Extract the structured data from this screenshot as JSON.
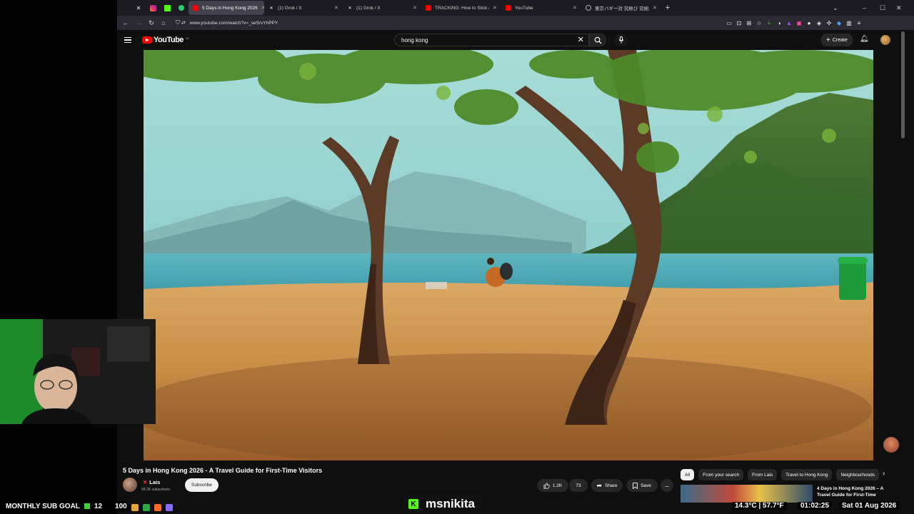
{
  "browser": {
    "tabs": [
      {
        "label": "5 Days in Hong Kong 2026",
        "active": true
      },
      {
        "label": "(1) Grok / X",
        "active": false
      },
      {
        "label": "(1) Grok / X",
        "active": false
      },
      {
        "label": "TRACKING: How to Stick an IM...",
        "active": false
      },
      {
        "label": "YouTube",
        "active": false
      },
      {
        "label": "東京バギー対 究極び 究極劇 - ...",
        "active": false
      }
    ],
    "new_tab": "+",
    "url": "www.youtube.com/watch?v=_seSrvYhPPY"
  },
  "youtube": {
    "logo": "YouTube",
    "region": "NL",
    "search_value": "hong kong",
    "create_label": "Create",
    "video": {
      "title": "5 Days in Hong Kong 2026 - A Travel Guide for First-Time Visitors",
      "channel": "Lais",
      "subscribers": "58.2K subscribers",
      "subscribe_label": "Subscribe",
      "likes": "1.2K",
      "comments": "73",
      "share_label": "Share",
      "save_label": "Save",
      "more": "..."
    },
    "chips": [
      "All",
      "From your search",
      "From Lais",
      "Travel to Hong Kong",
      "Neighbourhoods"
    ],
    "recommended": {
      "title": "4 Days in Hong Kong 2026 – A Travel Guide for First-Time"
    }
  },
  "stream": {
    "goal_label": "MONTHLY SUB GOAL",
    "goal_current": "12",
    "goal_target": "100",
    "streamer": "msnikita",
    "weather": "14.3°C | 57.7°F",
    "clock": "01:02:25",
    "date": "Sat 01 Aug 2026"
  },
  "colors": {
    "yt_red": "#ff0000",
    "kick_green": "#53fc18",
    "yt_bg": "#0f0f0f"
  }
}
